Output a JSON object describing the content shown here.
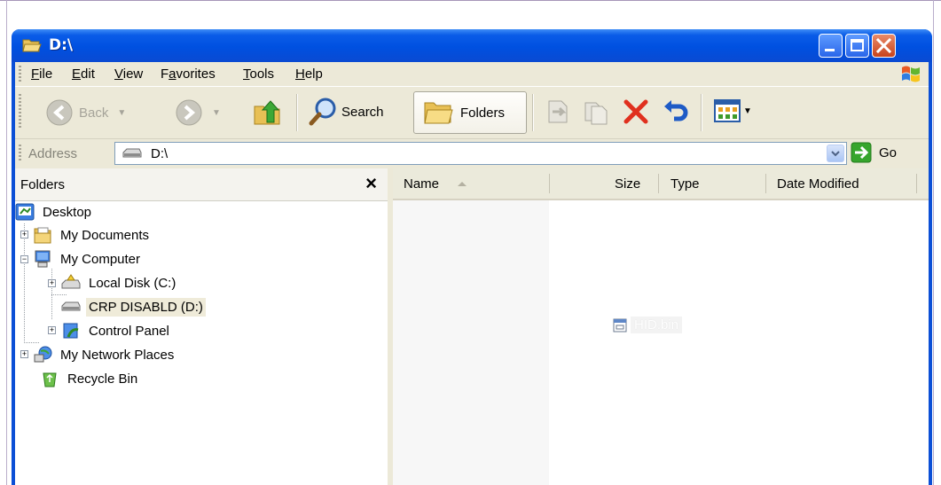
{
  "window": {
    "title": "D:\\"
  },
  "menu": {
    "items": [
      {
        "label": "File",
        "mnemonic": "F"
      },
      {
        "label": "Edit",
        "mnemonic": "E"
      },
      {
        "label": "View",
        "mnemonic": "V"
      },
      {
        "label": "Favorites",
        "mnemonic": "a"
      },
      {
        "label": "Tools",
        "mnemonic": "T"
      },
      {
        "label": "Help",
        "mnemonic": "H"
      }
    ]
  },
  "toolbar": {
    "back_label": "Back",
    "search_label": "Search",
    "folders_label": "Folders"
  },
  "address": {
    "label": "Address",
    "value": "D:\\",
    "go_label": "Go"
  },
  "folders_pane": {
    "title": "Folders",
    "close_glyph": "×",
    "tree": [
      {
        "label": "Desktop",
        "icon": "desktop-icon"
      },
      {
        "label": "My Documents",
        "icon": "my-documents-icon"
      },
      {
        "label": "My Computer",
        "icon": "my-computer-icon"
      },
      {
        "label": "Local Disk (C:)",
        "icon": "local-disk-icon"
      },
      {
        "label": "CRP DISABLD (D:)",
        "icon": "removable-drive-icon",
        "selected": true
      },
      {
        "label": "Control Panel",
        "icon": "control-panel-icon"
      },
      {
        "label": "My Network Places",
        "icon": "network-places-icon"
      },
      {
        "label": "Recycle Bin",
        "icon": "recycle-bin-icon"
      }
    ]
  },
  "file_list": {
    "columns": [
      "Name",
      "Size",
      "Type",
      "Date Modified"
    ],
    "files": [
      {
        "name": "HID.bin",
        "icon": "bin-file-icon"
      }
    ]
  },
  "colors": {
    "titlebar": "#0054e3",
    "face": "#ece9d8",
    "close_button": "#d6562b"
  }
}
